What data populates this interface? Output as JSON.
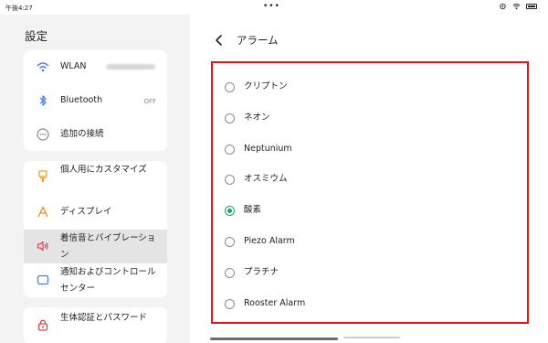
{
  "status_bar": {
    "time": "午後4:27",
    "dots": "•••",
    "icons": [
      "cast-icon",
      "wifi-icon",
      "battery-icon"
    ]
  },
  "sidebar": {
    "title": "設定",
    "items": [
      {
        "label": "WLAN",
        "value": "",
        "icon": "wifi-icon"
      },
      {
        "label": "Bluetooth",
        "value": "OFF",
        "icon": "bluetooth-icon"
      },
      {
        "label": "追加の接続",
        "value": "",
        "icon": "connection-icon"
      },
      {
        "label": "個人用にカスタマイズ",
        "value": "",
        "icon": "paint-brush-icon"
      },
      {
        "label": "ディスプレイ",
        "value": "",
        "icon": "display-icon"
      },
      {
        "label": "着信音とバイブレーション",
        "value": "",
        "icon": "speaker-icon",
        "selected": true
      },
      {
        "label": "通知およびコントロールセンター",
        "value": "",
        "icon": "notification-icon"
      },
      {
        "label": "生体認証とパスワード",
        "value": "",
        "icon": "lock-icon"
      }
    ]
  },
  "detail": {
    "title": "アラーム",
    "options": [
      {
        "label": "クリプトン",
        "checked": false
      },
      {
        "label": "ネオン",
        "checked": false
      },
      {
        "label": "Neptunium",
        "checked": false
      },
      {
        "label": "オスミウム",
        "checked": false
      },
      {
        "label": "酸素",
        "checked": true
      },
      {
        "label": "Piezo Alarm",
        "checked": false
      },
      {
        "label": "プラチナ",
        "checked": false
      },
      {
        "label": "Rooster Alarm",
        "checked": false
      }
    ]
  },
  "colors": {
    "accent_green": "#1aa36a",
    "highlight_red": "#e8141c",
    "wifi_blue": "#4a7bef",
    "brush_orange": "#f0a020",
    "display_orange": "#f08a2a",
    "speaker_red": "#e0404a",
    "notify_blue": "#4a7bef",
    "lock_red": "#e0404a"
  }
}
